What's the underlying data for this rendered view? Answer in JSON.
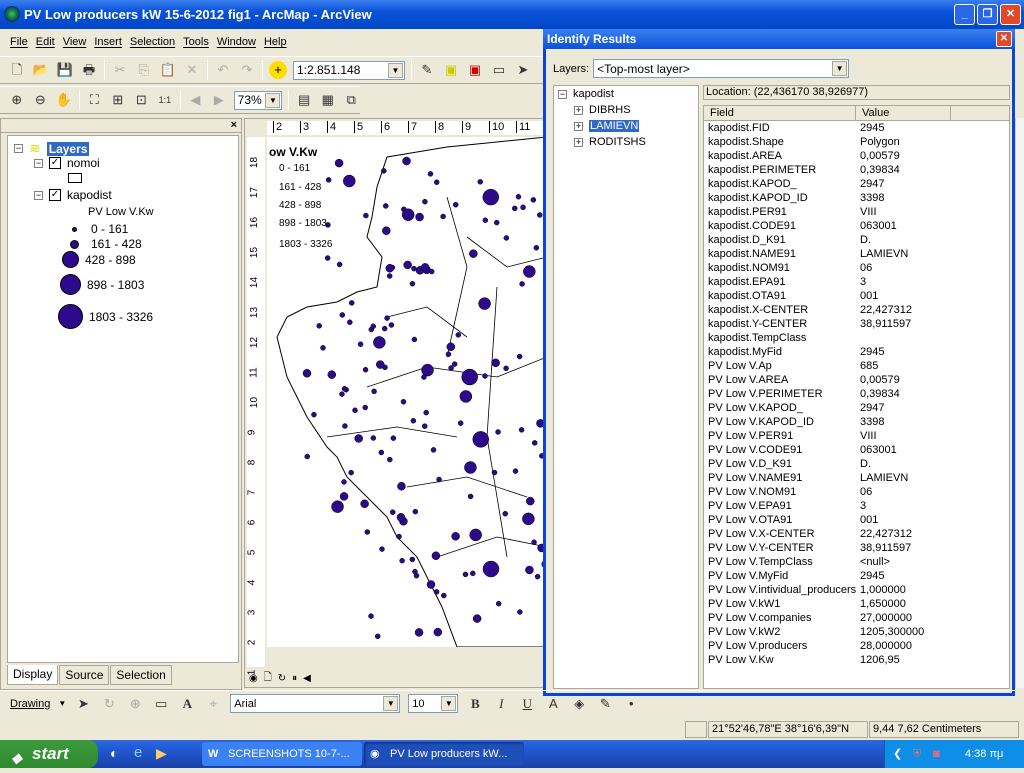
{
  "window": {
    "title": "PV Low producers kW 15-6-2012 fig1 - ArcMap - ArcView"
  },
  "menu": [
    "File",
    "Edit",
    "View",
    "Insert",
    "Selection",
    "Tools",
    "Window",
    "Help"
  ],
  "toolbar": {
    "scale": "1:2.851.148",
    "zoom": "73%"
  },
  "toc": {
    "root": "Layers",
    "layers": [
      {
        "name": "nomoi",
        "checked": true
      },
      {
        "name": "kapodist",
        "checked": true
      }
    ],
    "legend_title": "PV Low V.Kw",
    "classes": [
      "0 - 161",
      "161 - 428",
      "428 - 898",
      "898 - 1803",
      "1803 - 3326"
    ],
    "tabs": [
      "Display",
      "Source",
      "Selection"
    ]
  },
  "map": {
    "legend_title": "ow V.Kw",
    "legend_classes": [
      "0 - 161",
      "161 - 428",
      "428 - 898",
      "898 - 1803",
      "1803 - 3326"
    ],
    "ruler_top": [
      "2",
      "3",
      "4",
      "5",
      "6",
      "7",
      "8",
      "9",
      "10",
      "11"
    ],
    "ruler_left": [
      "18",
      "17",
      "16",
      "15",
      "14",
      "13",
      "12",
      "11",
      "10",
      "9",
      "8",
      "7",
      "6",
      "5",
      "4",
      "3",
      "2",
      "1"
    ],
    "symbol_color": "#2d0a8c"
  },
  "identify": {
    "title": "Identify Results",
    "layers_label": "Layers:",
    "layers_value": "<Top-most layer>",
    "tree_root": "kapodist",
    "tree_items": [
      "DIBRHS",
      "LAMIEVN",
      "RODITSHS"
    ],
    "selected": "LAMIEVN",
    "location": "Location: (22,436170 38,926977)",
    "col_field": "Field",
    "col_value": "Value",
    "rows": [
      [
        "kapodist.FID",
        "2945"
      ],
      [
        "kapodist.Shape",
        "Polygon"
      ],
      [
        "kapodist.AREA",
        "0,00579"
      ],
      [
        "kapodist.PERIMETER",
        "0,39834"
      ],
      [
        "kapodist.KAPOD_",
        "2947"
      ],
      [
        "kapodist.KAPOD_ID",
        "3398"
      ],
      [
        "kapodist.PER91",
        "VIII"
      ],
      [
        "kapodist.CODE91",
        "063001"
      ],
      [
        "kapodist.D_K91",
        "D."
      ],
      [
        "kapodist.NAME91",
        "LAMIEVN"
      ],
      [
        "kapodist.NOM91",
        "06"
      ],
      [
        "kapodist.EPA91",
        "3"
      ],
      [
        "kapodist.OTA91",
        "001"
      ],
      [
        "kapodist.X-CENTER",
        "22,427312"
      ],
      [
        "kapodist.Y-CENTER",
        "38,911597"
      ],
      [
        "kapodist.TempClass",
        ""
      ],
      [
        "kapodist.MyFid",
        "2945"
      ],
      [
        "PV Low V.Ap",
        "685"
      ],
      [
        "PV Low V.AREA",
        "0,00579"
      ],
      [
        "PV Low V.PERIMETER",
        "0,39834"
      ],
      [
        "PV Low V.KAPOD_",
        "2947"
      ],
      [
        "PV Low V.KAPOD_ID",
        "3398"
      ],
      [
        "PV Low V.PER91",
        "VIII"
      ],
      [
        "PV Low V.CODE91",
        "063001"
      ],
      [
        "PV Low V.D_K91",
        "D."
      ],
      [
        "PV Low V.NAME91",
        "LAMIEVN"
      ],
      [
        "PV Low V.NOM91",
        "06"
      ],
      [
        "PV Low V.EPA91",
        "3"
      ],
      [
        "PV Low V.OTA91",
        "001"
      ],
      [
        "PV Low V.X-CENTER",
        "22,427312"
      ],
      [
        "PV Low V.Y-CENTER",
        "38,911597"
      ],
      [
        "PV Low V.TempClass",
        "<null>"
      ],
      [
        "PV Low V.MyFid",
        "2945"
      ],
      [
        "PV Low V.intividual_producers",
        "1,000000"
      ],
      [
        "PV Low V.kW1",
        "1,650000"
      ],
      [
        "PV Low V.companies",
        "27,000000"
      ],
      [
        "PV Low V.kW2",
        "1205,300000"
      ],
      [
        "PV Low V.producers",
        "28,000000"
      ],
      [
        "PV Low V.Kw",
        "1206,95"
      ]
    ]
  },
  "drawing": {
    "label": "Drawing",
    "font": "Arial",
    "size": "10",
    "bold": "B",
    "italic": "I",
    "underline": "U"
  },
  "status": {
    "coords": "21°52'46,78\"E  38°16'6,39\"N",
    "page": "9,44  7,62 Centimeters"
  },
  "taskbar": {
    "start": "start",
    "tasks": [
      "SCREENSHOTS 10-7-...",
      "PV Low producers kW..."
    ],
    "lang": "EN",
    "clock": "4:38 πμ"
  }
}
